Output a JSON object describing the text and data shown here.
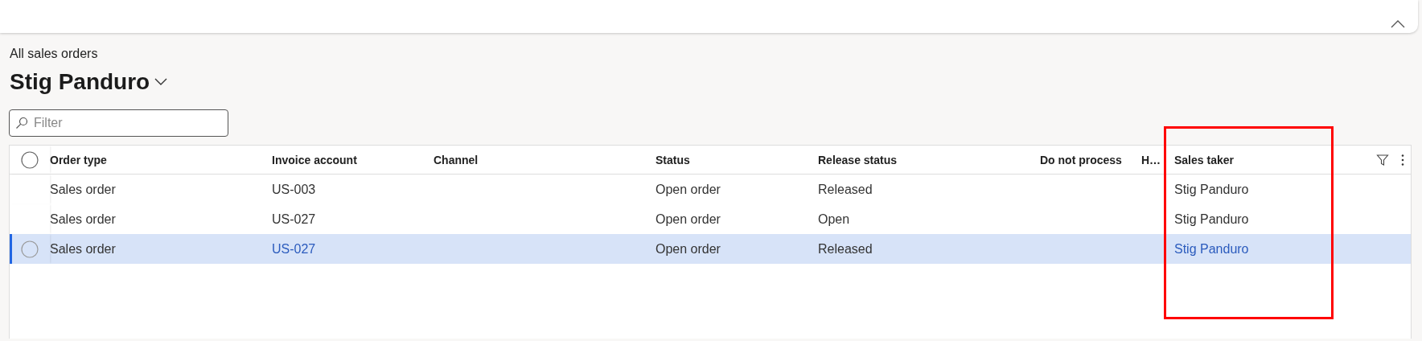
{
  "breadcrumb": "All sales orders",
  "title": "Stig Panduro",
  "filter": {
    "placeholder": "Filter"
  },
  "table": {
    "columns": [
      {
        "label": "Order type"
      },
      {
        "label": "Invoice account",
        "kind": "link"
      },
      {
        "label": "Channel"
      },
      {
        "label": "Status"
      },
      {
        "label": "Release status"
      },
      {
        "label": "Do not process"
      },
      {
        "label": "H…"
      },
      {
        "label": "Sales taker",
        "kind": "link"
      }
    ],
    "select_all": {
      "checked": false
    },
    "rows": [
      {
        "selected": false,
        "cells": [
          "Sales order",
          "US-003",
          "",
          "Open order",
          "Released",
          "",
          "",
          "Stig Panduro"
        ]
      },
      {
        "selected": false,
        "cells": [
          "Sales order",
          "US-027",
          "",
          "Open order",
          "Open",
          "",
          "",
          "Stig Panduro"
        ]
      },
      {
        "selected": true,
        "cells": [
          "Sales order",
          "US-027",
          "",
          "Open order",
          "Released",
          "",
          "",
          "Stig Panduro"
        ]
      }
    ]
  },
  "highlight": {
    "kind": "rectangle"
  }
}
